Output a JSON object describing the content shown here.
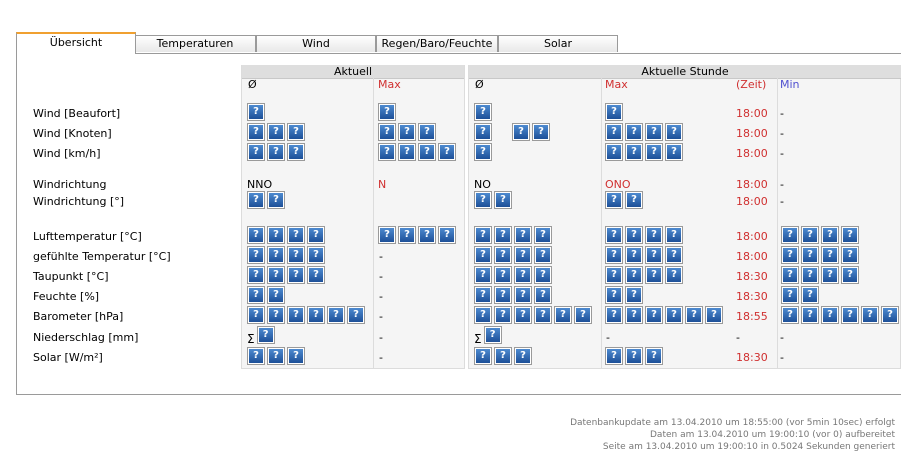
{
  "tabs": [
    "Übersicht",
    "Temperaturen",
    "Wind",
    "Regen/Baro/Feuchte",
    "Solar"
  ],
  "groups": {
    "current": "Aktuell",
    "hour": "Aktuelle Stunde"
  },
  "columns": {
    "avg": "Ø",
    "max": "Max",
    "time": "(Zeit)",
    "min": "Min"
  },
  "rows": {
    "wind_bft": "Wind [Beaufort]",
    "wind_kn": "Wind [Knoten]",
    "wind_kmh": "Wind [km/h]",
    "wind_dir": "Windrichtung",
    "wind_dir_deg": "Windrichtung [°]",
    "air_temp": "Lufttemperatur [°C]",
    "felt_temp": "gefühlte Temperatur [°C]",
    "dew": "Taupunkt [°C]",
    "humidity": "Feuchte [%]",
    "baro": "Barometer [hPa]",
    "rain": "Niederschlag [mm]",
    "solar": "Solar [W/m²]"
  },
  "values": {
    "cur_dir": "NNO",
    "cur_max_dir": "N",
    "hr_dir": "NO",
    "hr_max_dir": "ONO",
    "dash": "-",
    "sigma": "Σ",
    "times": [
      "18:00",
      "18:00",
      "18:00",
      "18:00",
      "18:00",
      "18:00",
      "18:00",
      "18:30",
      "18:30",
      "18:55",
      "-",
      "18:30"
    ]
  },
  "image_glyph": "?",
  "footer": {
    "line1": "Datenbankupdate am 13.04.2010 um 18:55:00 (vor 5min 10sec) erfolgt",
    "line2": "Daten am 13.04.2010 um 19:00:10 (vor 0) aufbereitet",
    "line3": "Seite am 13.04.2010 um 19:00:10 in 0.5024 Sekunden generiert"
  },
  "colors": {
    "accent": "#f0a030",
    "max": "#d03030",
    "min": "#5050d0",
    "icon": "#2a64b0"
  }
}
